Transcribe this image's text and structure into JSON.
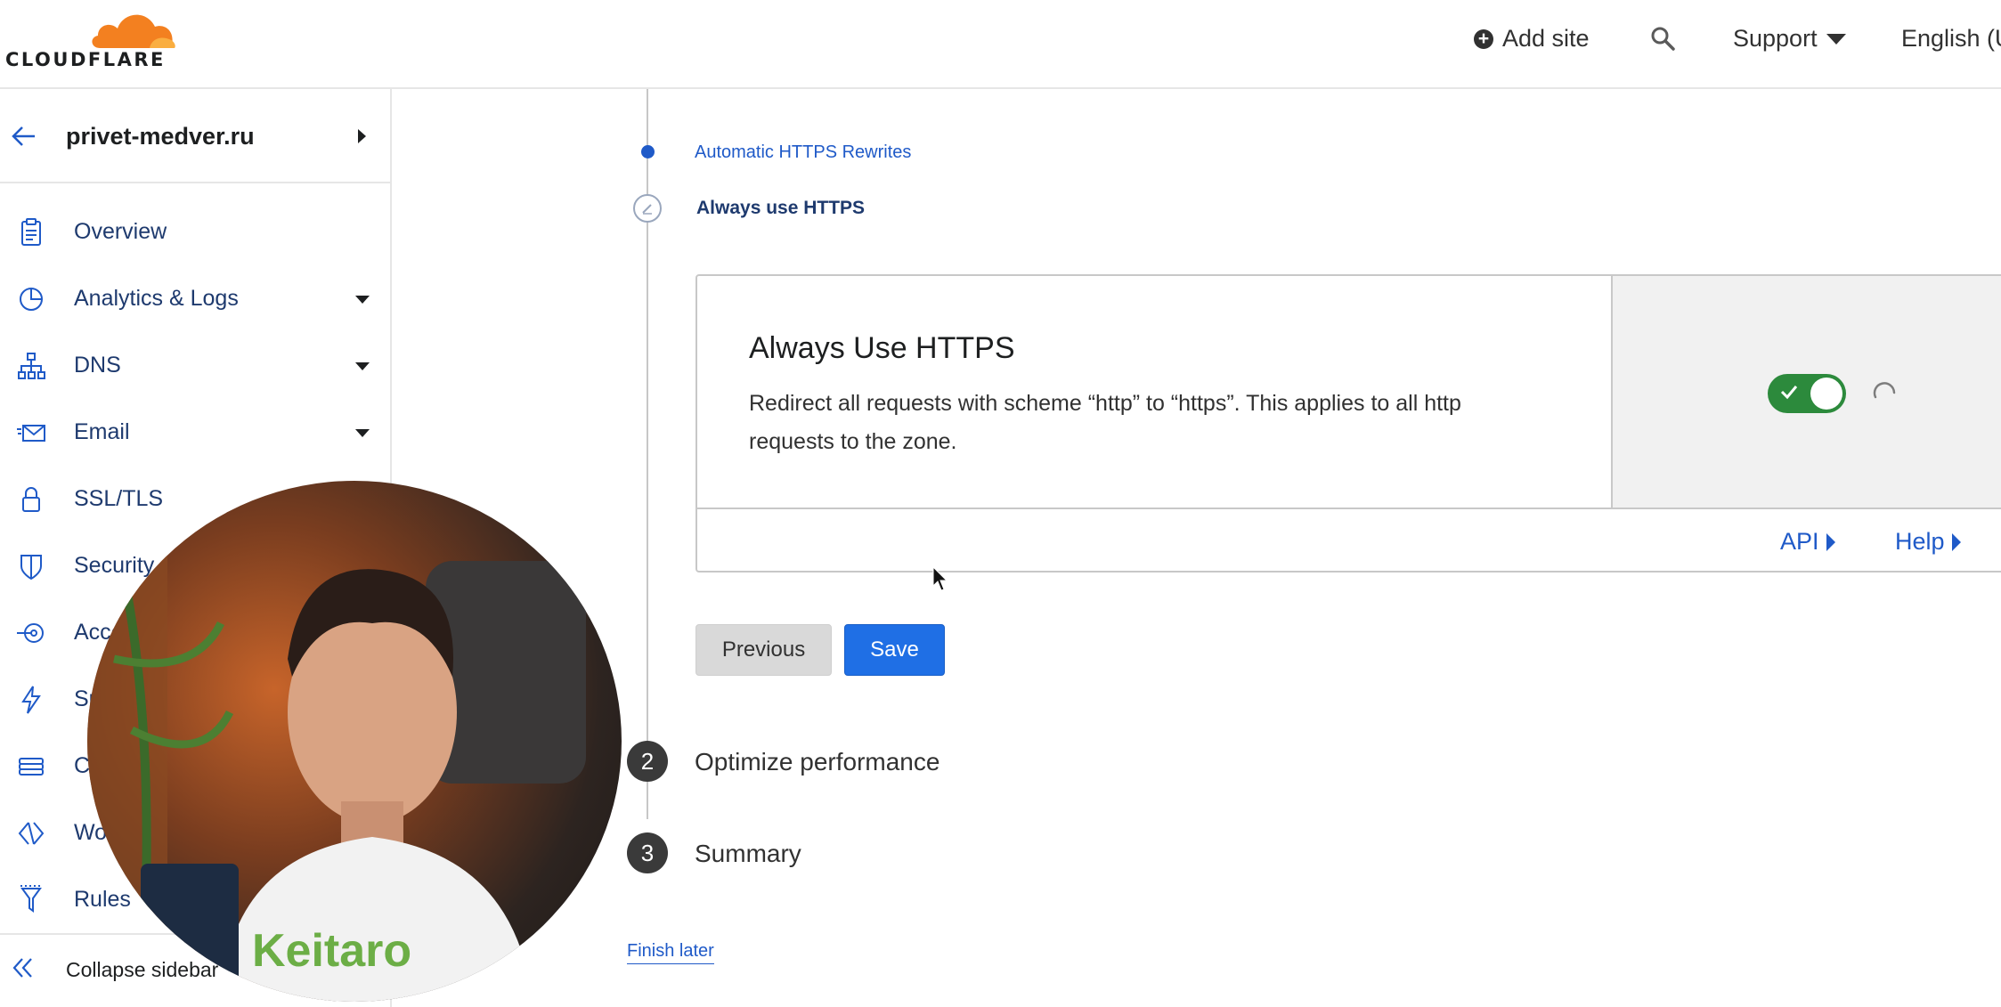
{
  "header": {
    "logo_text": "CLOUDFLARE",
    "add_site": "Add site",
    "support": "Support",
    "language": "English (U"
  },
  "sidebar": {
    "site_name": "privet-medver.ru",
    "items": [
      {
        "label": "Overview",
        "icon": "clipboard-icon",
        "dropdown": false
      },
      {
        "label": "Analytics & Logs",
        "icon": "pie-chart-icon",
        "dropdown": true
      },
      {
        "label": "DNS",
        "icon": "network-icon",
        "dropdown": true
      },
      {
        "label": "Email",
        "icon": "envelope-icon",
        "dropdown": true
      },
      {
        "label": "SSL/TLS",
        "icon": "lock-icon",
        "dropdown": false
      },
      {
        "label": "Security",
        "icon": "shield-icon",
        "dropdown": false
      },
      {
        "label": "Acce",
        "icon": "access-icon",
        "dropdown": false
      },
      {
        "label": "Sp",
        "icon": "lightning-icon",
        "dropdown": false
      },
      {
        "label": "C",
        "icon": "cache-icon",
        "dropdown": false
      },
      {
        "label": "Wo",
        "icon": "workers-icon",
        "dropdown": false
      },
      {
        "label": "Rules",
        "icon": "rules-icon",
        "dropdown": false
      }
    ],
    "collapse_label": "Collapse sidebar"
  },
  "main": {
    "step_link": "Automatic HTTPS Rewrites",
    "step_current": "Always use HTTPS",
    "card": {
      "title": "Always Use HTTPS",
      "description": "Redirect all requests with scheme “http” to “https”. This applies to all http requests to the zone.",
      "toggle_on": true,
      "api_link": "API",
      "help_link": "Help"
    },
    "buttons": {
      "previous": "Previous",
      "save": "Save"
    },
    "steps": [
      {
        "number": "2",
        "title": "Optimize performance"
      },
      {
        "number": "3",
        "title": "Summary"
      }
    ],
    "finish_later": "Finish later"
  },
  "colors": {
    "brand_orange": "#f38020",
    "link_blue": "#1f5ac8",
    "primary_button": "#1f6fe5",
    "toggle_green": "#2c8a3c"
  }
}
